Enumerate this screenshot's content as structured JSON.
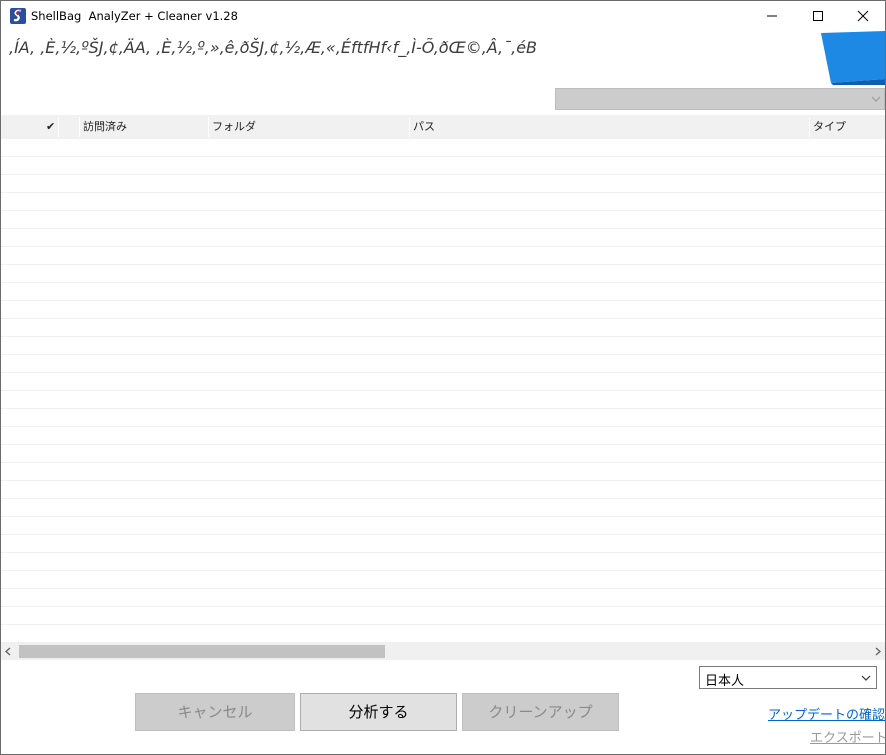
{
  "window": {
    "title": "ShellBag  AnalyZer + Cleaner v1.28",
    "controls": {
      "minimize": "minimize-icon",
      "maximize": "maximize-icon",
      "close": "close-icon"
    }
  },
  "header": {
    "garbled_text": ",ÍA, ,È,½,ºŠJ,¢,ÄA, ,È,½,º,»,ê,ðŠJ,¢,½,Æ,«,ÉftfHf‹f_,Ì-Õ,ðŒ©,Â,¯,éB",
    "accent_color": "#1e88e5"
  },
  "filter_combo": {
    "value": ""
  },
  "list": {
    "columns": [
      {
        "label": "✔"
      },
      {
        "label": ""
      },
      {
        "label": "訪問済み"
      },
      {
        "label": "フォルダ"
      },
      {
        "label": "パス"
      },
      {
        "label": "タイプ"
      }
    ],
    "rows": []
  },
  "language_select": {
    "value": "日本人"
  },
  "buttons": {
    "cancel": "キャンセル",
    "analyze": "分析する",
    "cleanup": "クリーンアップ"
  },
  "links": {
    "check_update": "アップデートの確認",
    "export": "エクスポート"
  }
}
